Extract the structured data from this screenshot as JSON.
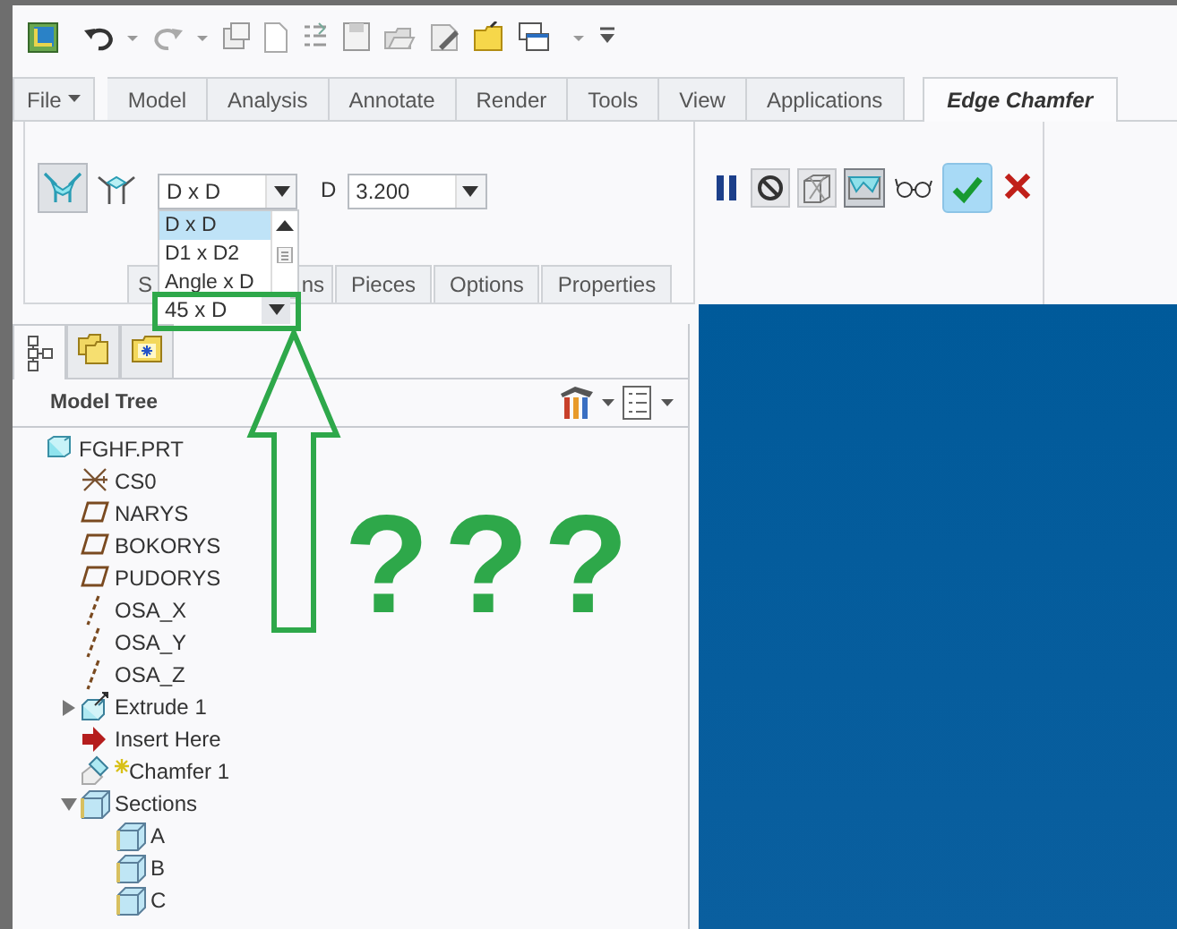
{
  "quick_access_toolbar": {
    "items": [
      {
        "kind": "app"
      },
      {
        "kind": "undo"
      },
      {
        "kind": "caret"
      },
      {
        "kind": "redo"
      },
      {
        "kind": "caret"
      },
      {
        "kind": "regen"
      },
      {
        "kind": "new"
      },
      {
        "kind": "list"
      },
      {
        "kind": "save"
      },
      {
        "kind": "open"
      },
      {
        "kind": "rename"
      },
      {
        "kind": "folder"
      },
      {
        "kind": "windows"
      },
      {
        "kind": "caret"
      },
      {
        "kind": "more"
      }
    ]
  },
  "ribbon_tabs": [
    {
      "label": "File",
      "kind": "menu",
      "selected": false
    },
    {
      "label": "Model",
      "kind": "tab",
      "selected": false
    },
    {
      "label": "Analysis",
      "kind": "tab",
      "selected": false
    },
    {
      "label": "Annotate",
      "kind": "tab",
      "selected": false
    },
    {
      "label": "Render",
      "kind": "tab",
      "selected": false
    },
    {
      "label": "Tools",
      "kind": "tab",
      "selected": false
    },
    {
      "label": "View",
      "kind": "tab",
      "selected": false
    },
    {
      "label": "Applications",
      "kind": "tab",
      "selected": false
    },
    {
      "label": "Edge Chamfer",
      "kind": "tab",
      "selected": true
    }
  ],
  "dashboard": {
    "chamfer_types": [
      {
        "kind": "edge",
        "selected": true
      },
      {
        "kind": "corner",
        "selected": false
      }
    ],
    "dimension_scheme": {
      "value": "D x D",
      "options": [
        {
          "label": "D x D",
          "selected": true
        },
        {
          "label": "D1 x D2",
          "selected": false
        },
        {
          "label": "Angle x D",
          "selected": false
        }
      ],
      "current": "45 x D"
    },
    "d_label": "D",
    "d_value": "3.200",
    "tabs": [
      {
        "label": "S"
      },
      {
        "label": "ns"
      },
      {
        "label": "Pieces"
      },
      {
        "label": "Options"
      },
      {
        "label": "Properties"
      }
    ],
    "tools": [
      {
        "kind": "pause"
      },
      {
        "kind": "no-preview"
      },
      {
        "kind": "geometry-preview"
      },
      {
        "kind": "verify-preview",
        "on": true
      },
      {
        "kind": "glasses"
      },
      {
        "kind": "ok",
        "on": true
      },
      {
        "kind": "cancel"
      }
    ]
  },
  "navigator_tabs": [
    {
      "kind": "tree",
      "selected": true
    },
    {
      "kind": "folders",
      "selected": false
    },
    {
      "kind": "favorites",
      "selected": false
    }
  ],
  "model_tree": {
    "title": "Model Tree",
    "items": [
      {
        "label": "FGHF.PRT",
        "kind": "part",
        "children": [
          {
            "label": "CS0",
            "kind": "csys"
          },
          {
            "label": "NARYS",
            "kind": "plane"
          },
          {
            "label": "BOKORYS",
            "kind": "plane"
          },
          {
            "label": "PUDORYS",
            "kind": "plane"
          },
          {
            "label": "OSA_X",
            "kind": "axis"
          },
          {
            "label": "OSA_Y",
            "kind": "axis"
          },
          {
            "label": "OSA_Z",
            "kind": "axis"
          },
          {
            "label": "Extrude 1",
            "kind": "extrude",
            "expanded": false
          },
          {
            "label": "Insert Here",
            "kind": "insert"
          },
          {
            "label": "Chamfer 1",
            "kind": "chamfer",
            "new": true
          },
          {
            "label": "Sections",
            "kind": "section",
            "expanded": true,
            "children": [
              {
                "label": "A",
                "kind": "section"
              },
              {
                "label": "B",
                "kind": "section"
              },
              {
                "label": "C",
                "kind": "section"
              }
            ]
          }
        ]
      }
    ]
  },
  "annotation": {
    "text": "???"
  }
}
